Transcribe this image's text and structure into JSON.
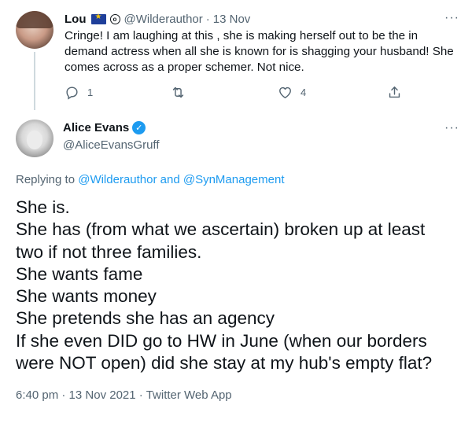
{
  "reply_tweet": {
    "author_name": "Lou",
    "author_handle": "@Wilderauthor",
    "separator": "·",
    "date": "13 Nov",
    "more_label": "···",
    "text": "Cringe! I am laughing at this , she is making herself out to be the in demand actress when all she is known for is shagging your husband! She comes across as a proper schemer. Not nice.",
    "actions": {
      "reply_count": "1",
      "retweet_count": "",
      "like_count": "4"
    }
  },
  "main_tweet": {
    "author_name": "Alice Evans",
    "author_handle": "@AliceEvansGruff",
    "more_label": "···",
    "replying_prefix": "Replying to",
    "replying_user1": "@Wilderauthor",
    "replying_and": "and",
    "replying_user2": "@SynManagement",
    "lines": [
      "She is.",
      "She has (from what we ascertain) broken up at least",
      "two if not three families.",
      "She wants fame",
      "She wants money",
      "She pretends she has an agency",
      "If she even DID go to HW in June (when our borders",
      "were NOT open) did she stay at my hub's empty flat?"
    ],
    "time": "6:40 pm",
    "sep": "·",
    "date": "13 Nov 2021",
    "client": "Twitter Web App"
  },
  "colors": {
    "accent": "#1d9bf0",
    "text": "#0f1419",
    "secondary": "#536471",
    "thread_line": "#cfd9de"
  }
}
